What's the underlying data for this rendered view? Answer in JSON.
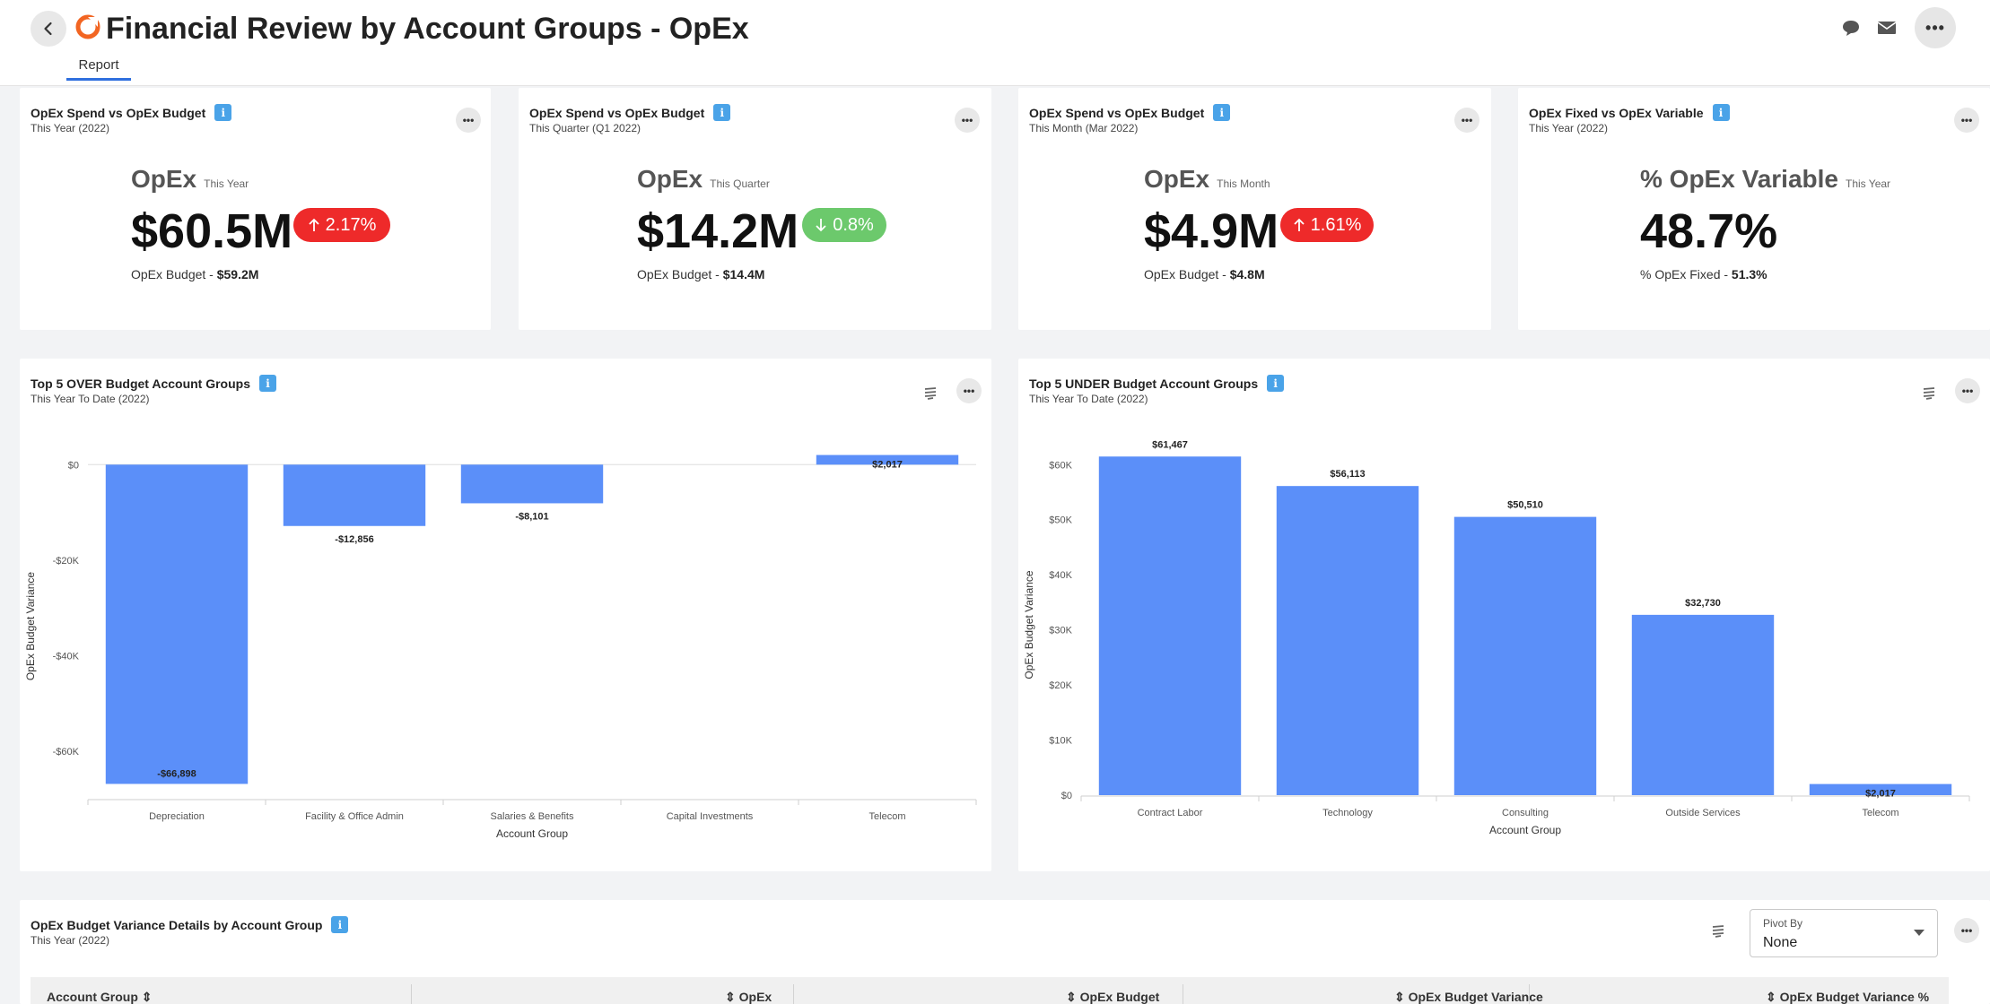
{
  "header": {
    "title": "Financial Review by Account Groups - OpEx",
    "tab": "Report"
  },
  "colors": {
    "accent": "#2f6fde",
    "bar": "#5b8ff9",
    "up": "#ee2a2a",
    "down": "#6cc96c",
    "info": "#4aa3e8"
  },
  "icons": [
    "chevron-left-icon",
    "app-logo-icon",
    "chat-icon",
    "mail-icon",
    "more-icon",
    "info-icon",
    "filter-icon",
    "arrow-up-icon",
    "arrow-down-icon"
  ],
  "kpis": [
    {
      "title": "OpEx Spend vs OpEx Budget",
      "subtitle": "This Year (2022)",
      "label": "OpEx",
      "label_small": "This Year",
      "value": "$60.5M",
      "badge": "2.17%",
      "badge_dir": "up",
      "foot_label": "OpEx Budget - ",
      "foot_value": "$59.2M"
    },
    {
      "title": "OpEx Spend vs OpEx Budget",
      "subtitle": "This Quarter (Q1 2022)",
      "label": "OpEx",
      "label_small": "This Quarter",
      "value": "$14.2M",
      "badge": "0.8%",
      "badge_dir": "down",
      "foot_label": "OpEx Budget - ",
      "foot_value": "$14.4M"
    },
    {
      "title": "OpEx Spend vs OpEx Budget",
      "subtitle": "This Month (Mar 2022)",
      "label": "OpEx",
      "label_small": "This Month",
      "value": "$4.9M",
      "badge": "1.61%",
      "badge_dir": "up",
      "foot_label": "OpEx Budget - ",
      "foot_value": "$4.8M"
    },
    {
      "title": "OpEx Fixed vs OpEx Variable",
      "subtitle": "This Year (2022)",
      "label": "% OpEx Variable",
      "label_small": "This Year",
      "value": "48.7%",
      "badge": "",
      "badge_dir": "",
      "foot_label": "% OpEx Fixed - ",
      "foot_value": "51.3%"
    }
  ],
  "charts": {
    "over": {
      "title": "Top 5 OVER Budget Account Groups",
      "subtitle": "This Year To Date (2022)"
    },
    "under": {
      "title": "Top 5 UNDER Budget Account Groups",
      "subtitle": "This Year To Date (2022)"
    }
  },
  "chart_data": [
    {
      "type": "bar",
      "title": "Top 5 OVER Budget Account Groups",
      "xlabel": "Account Group",
      "ylabel": "OpEx Budget Variance",
      "categories": [
        "Depreciation",
        "Facility & Office Admin",
        "Salaries & Benefits",
        "Capital Investments",
        "Telecom"
      ],
      "values": [
        -66898,
        -12856,
        -8101,
        0,
        2017
      ],
      "labels": [
        "-$66,898",
        "-$12,856",
        "-$8,101",
        "",
        "$2,017"
      ],
      "ylim": [
        -70000,
        2500
      ],
      "yticks": [
        0,
        -20000,
        -40000,
        -60000
      ],
      "ytick_labels": [
        "$0",
        "-$20K",
        "-$40K",
        "-$60K"
      ],
      "grid": false
    },
    {
      "type": "bar",
      "title": "Top 5 UNDER Budget Account Groups",
      "xlabel": "Account Group",
      "ylabel": "OpEx Budget Variance",
      "categories": [
        "Contract Labor",
        "Technology",
        "Consulting",
        "Outside Services",
        "Telecom"
      ],
      "values": [
        61467,
        56113,
        50510,
        32730,
        2017
      ],
      "labels": [
        "$61,467",
        "$56,113",
        "$50,510",
        "$32,730",
        "$2,017"
      ],
      "ylim": [
        0,
        62000
      ],
      "yticks": [
        0,
        10000,
        20000,
        30000,
        40000,
        50000,
        60000
      ],
      "ytick_labels": [
        "$0",
        "$10K",
        "$20K",
        "$30K",
        "$40K",
        "$50K",
        "$60K"
      ],
      "grid": false
    }
  ],
  "table": {
    "title": "OpEx Budget Variance Details by Account Group",
    "subtitle": "This Year (2022)",
    "pivot_label": "Pivot By",
    "pivot_value": "None",
    "columns": [
      "Account Group",
      "OpEx",
      "OpEx Budget",
      "OpEx Budget Variance",
      "OpEx Budget Variance %"
    ]
  }
}
